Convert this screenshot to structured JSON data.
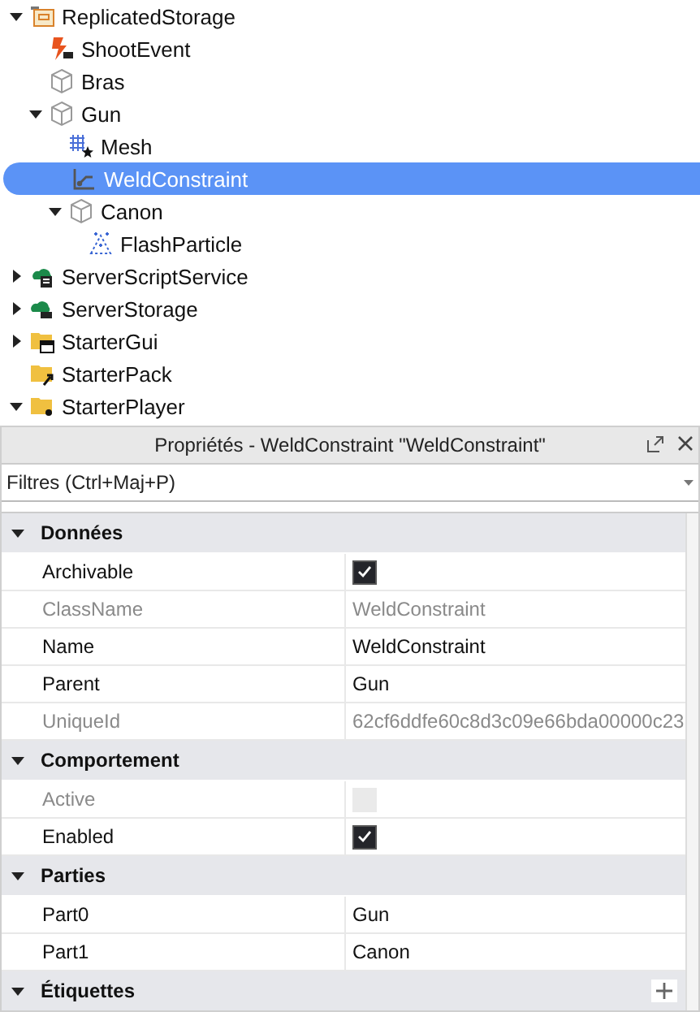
{
  "explorer": {
    "items": [
      {
        "label": "ReplicatedStorage",
        "kind": "storage",
        "expanded": true,
        "selected": false,
        "children": [
          {
            "label": "ShootEvent",
            "kind": "event",
            "selected": false
          },
          {
            "label": "Bras",
            "kind": "part",
            "selected": false
          },
          {
            "label": "Gun",
            "kind": "part",
            "expanded": true,
            "selected": false,
            "children": [
              {
                "label": "Mesh",
                "kind": "mesh",
                "selected": false
              },
              {
                "label": "WeldConstraint",
                "kind": "weld",
                "selected": true
              },
              {
                "label": "Canon",
                "kind": "part",
                "expanded": true,
                "selected": false,
                "children": [
                  {
                    "label": "FlashParticle",
                    "kind": "particle",
                    "selected": false
                  }
                ]
              }
            ]
          }
        ]
      },
      {
        "label": "ServerScriptService",
        "kind": "script-service",
        "expanded": false,
        "selected": false
      },
      {
        "label": "ServerStorage",
        "kind": "server-storage",
        "expanded": false,
        "selected": false
      },
      {
        "label": "StarterGui",
        "kind": "gui",
        "expanded": false,
        "selected": false
      },
      {
        "label": "StarterPack",
        "kind": "pack",
        "selected": false
      },
      {
        "label": "StarterPlayer",
        "kind": "player",
        "expanded": true,
        "selected": false
      }
    ]
  },
  "properties": {
    "title": "Propriétés - WeldConstraint \"WeldConstraint\"",
    "filter_placeholder": "Filtres (Ctrl+Maj+P)",
    "categories": [
      {
        "name": "Données",
        "expanded": true,
        "rows": [
          {
            "name": "Archivable",
            "kind": "checkbox",
            "checked": true,
            "disabled": false
          },
          {
            "name": "ClassName",
            "kind": "text",
            "value": "WeldConstraint",
            "disabled": true
          },
          {
            "name": "Name",
            "kind": "text",
            "value": "WeldConstraint",
            "disabled": false
          },
          {
            "name": "Parent",
            "kind": "text",
            "value": "Gun",
            "disabled": false
          },
          {
            "name": "UniqueId",
            "kind": "text",
            "value": "62cf6ddfe60c8d3c09e66bda00000c23",
            "disabled": true
          }
        ]
      },
      {
        "name": "Comportement",
        "expanded": true,
        "rows": [
          {
            "name": "Active",
            "kind": "checkbox",
            "checked": false,
            "disabled": true
          },
          {
            "name": "Enabled",
            "kind": "checkbox",
            "checked": true,
            "disabled": false
          }
        ]
      },
      {
        "name": "Parties",
        "expanded": true,
        "rows": [
          {
            "name": "Part0",
            "kind": "text",
            "value": "Gun",
            "disabled": false
          },
          {
            "name": "Part1",
            "kind": "text",
            "value": "Canon",
            "disabled": false
          }
        ]
      },
      {
        "name": "Étiquettes",
        "expanded": true,
        "addable": true
      }
    ]
  }
}
